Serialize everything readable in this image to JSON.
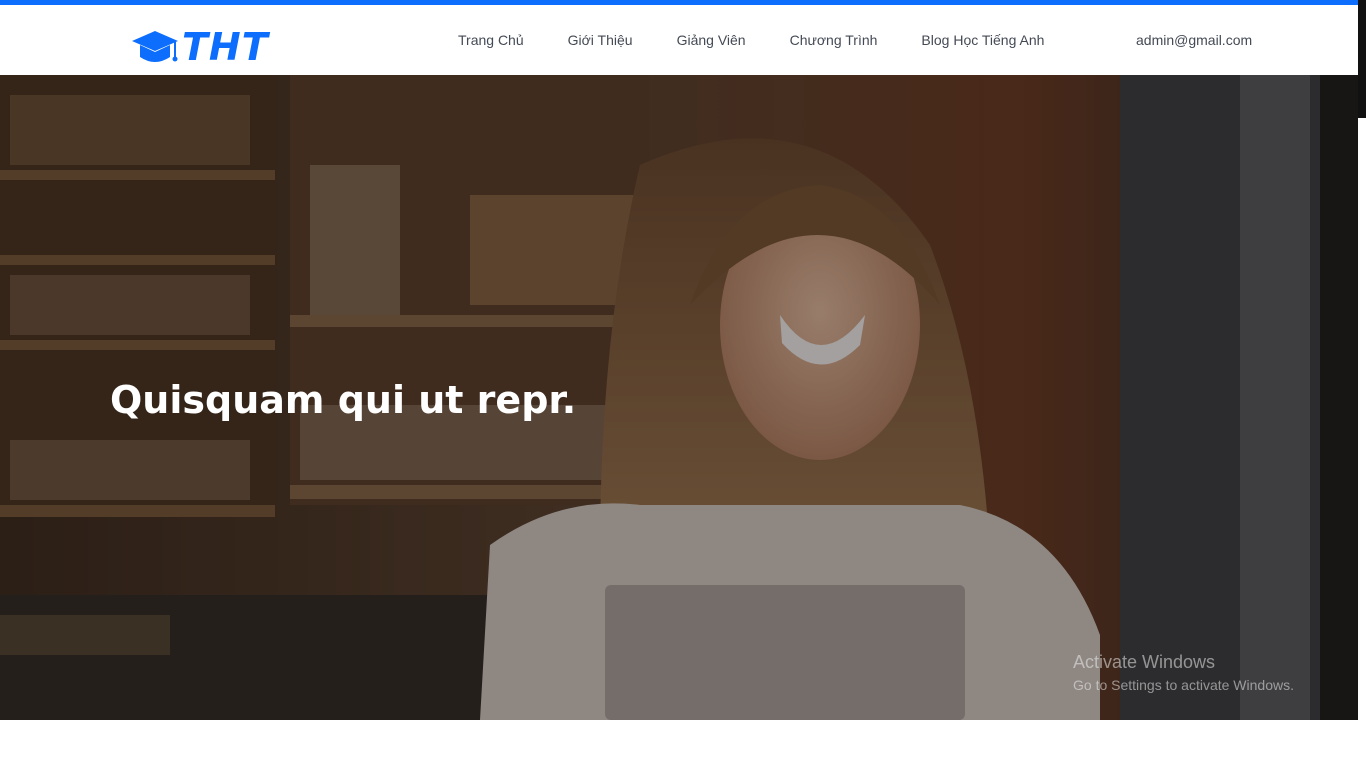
{
  "brand": {
    "logo_text": "THT",
    "logo_icon": "graduation-cap-icon",
    "accent_color": "#0d6efd"
  },
  "nav": {
    "items": [
      {
        "label": "Trang Chủ"
      },
      {
        "label": "Giới Thiệu"
      },
      {
        "label": "Giảng Viên"
      },
      {
        "label": "Chương Trình"
      },
      {
        "label": "Blog Học Tiếng Anh"
      }
    ],
    "email": "admin@gmail.com"
  },
  "hero": {
    "title": "Quisquam qui ut repr.",
    "background": "smiling woman holding a tablet in a cafe"
  },
  "watermark": {
    "line1": "Activate Windows",
    "line2": "Go to Settings to activate Windows."
  }
}
